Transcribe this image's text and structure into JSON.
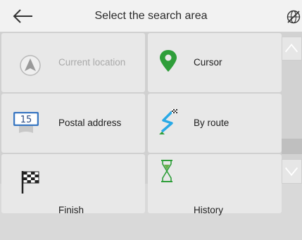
{
  "header": {
    "title": "Select the search area",
    "back_icon": "arrow-left-icon",
    "corner_icon": "globe-off-icon"
  },
  "tiles": [
    {
      "label": "Current location",
      "icon": "navigation-arrow-icon",
      "disabled": true
    },
    {
      "label": "Cursor",
      "icon": "map-pin-icon",
      "disabled": false
    },
    {
      "label": "Postal address",
      "icon": "postal-code-sign-icon",
      "badge": "15",
      "disabled": false
    },
    {
      "label": "By route",
      "icon": "route-flag-icon",
      "disabled": false
    },
    {
      "label": "Finish",
      "icon": "checkered-flag-icon",
      "disabled": false
    },
    {
      "label": "History",
      "icon": "hourglass-icon",
      "disabled": false
    }
  ],
  "scrollbar": {
    "up_icon": "chevron-up-icon",
    "down_icon": "chevron-down-icon"
  },
  "colors": {
    "header_bg": "#f2f2f2",
    "tile_bg": "#e8e8e8",
    "grid_bg": "#d0d0d0",
    "pin_green": "#2f9e3a",
    "route_blue": "#29a9e6"
  }
}
